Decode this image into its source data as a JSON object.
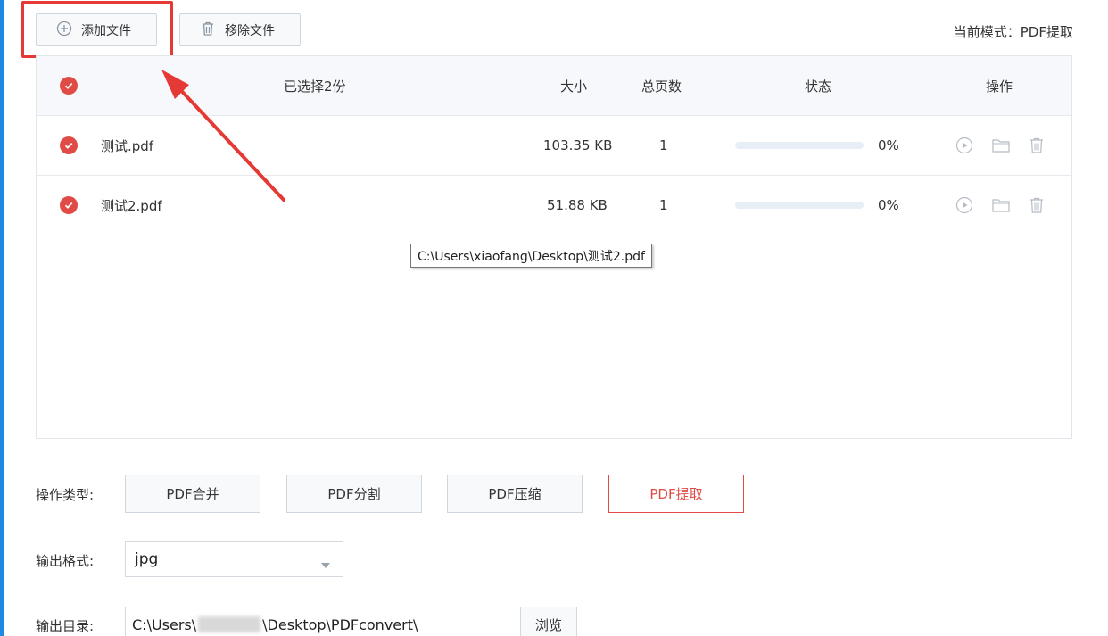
{
  "toolbar": {
    "add_label": "添加文件",
    "remove_label": "移除文件",
    "mode_text": "当前模式：PDF提取"
  },
  "table": {
    "headers": {
      "selected": "已选择2份",
      "size": "大小",
      "pages": "总页数",
      "status": "状态",
      "actions": "操作"
    },
    "rows": [
      {
        "name": "测试.pdf",
        "size": "103.35 KB",
        "pages": "1",
        "progress_text": "0%",
        "progress": 0
      },
      {
        "name": "测试2.pdf",
        "size": "51.88 KB",
        "pages": "1",
        "progress_text": "0%",
        "progress": 0
      }
    ]
  },
  "tooltip": {
    "text": "C:\\Users\\xiaofang\\Desktop\\测试2.pdf"
  },
  "operation": {
    "label": "操作类型:",
    "types": [
      "PDF合并",
      "PDF分割",
      "PDF压缩",
      "PDF提取"
    ],
    "active": "PDF提取"
  },
  "output_format": {
    "label": "输出格式:",
    "value": "jpg"
  },
  "output_dir": {
    "label": "输出目录:",
    "prefix": "C:\\Users\\",
    "suffix": "\\Desktop\\PDFconvert\\",
    "browse_label": "浏览"
  },
  "colors": {
    "accent_red": "#e04b45",
    "annotation_red": "#e53935",
    "primary_blue": "#1e88e5"
  }
}
